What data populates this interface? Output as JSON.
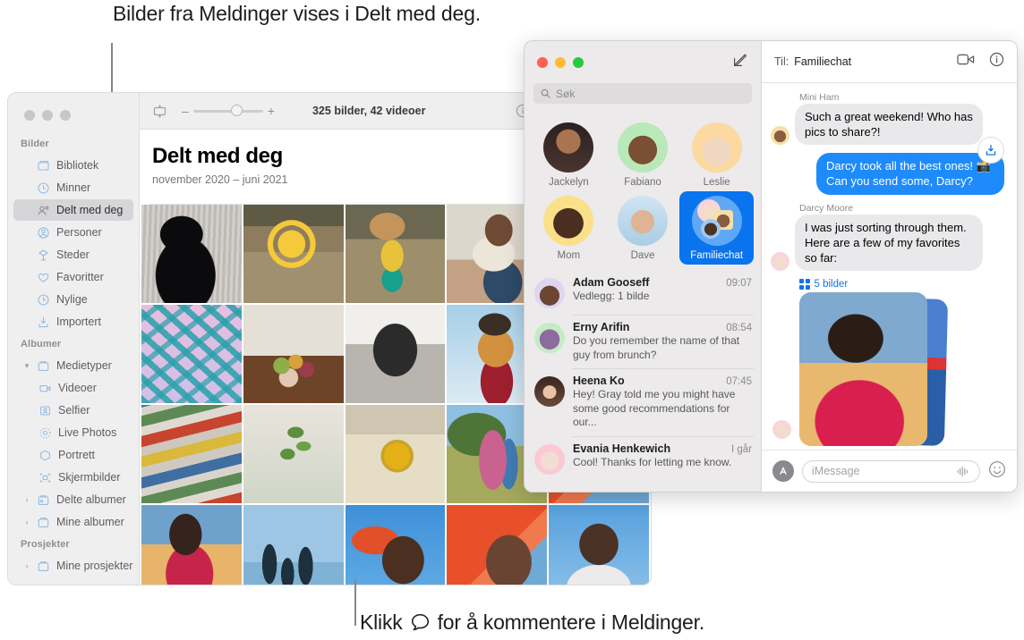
{
  "annotations": {
    "top": "Bilder fra Meldinger vises i Delt med deg.",
    "bottom_before": "Klikk",
    "bottom_after": "for å kommentere i Meldinger."
  },
  "photos": {
    "toolbar": {
      "count_label": "325 bilder, 42 videoer",
      "minus": "–",
      "plus": "+",
      "icons": [
        "slideshow-icon",
        "info-icon",
        "share-icon",
        "favorite-icon",
        "rotate-icon"
      ]
    },
    "header": {
      "title": "Delt med deg",
      "subtitle": "november 2020 – juni 2021"
    },
    "sidebar": {
      "sections": [
        {
          "heading": "Bilder",
          "items": [
            {
              "label": "Bibliotek",
              "icon": "library-icon",
              "selected": false,
              "indent": false,
              "chevron": ""
            },
            {
              "label": "Minner",
              "icon": "memories-icon",
              "selected": false,
              "indent": false,
              "chevron": ""
            },
            {
              "label": "Delt med deg",
              "icon": "shared-with-you-icon",
              "selected": true,
              "indent": false,
              "chevron": ""
            },
            {
              "label": "Personer",
              "icon": "people-icon",
              "selected": false,
              "indent": false,
              "chevron": ""
            },
            {
              "label": "Steder",
              "icon": "places-icon",
              "selected": false,
              "indent": false,
              "chevron": ""
            },
            {
              "label": "Favoritter",
              "icon": "heart-icon",
              "selected": false,
              "indent": false,
              "chevron": ""
            },
            {
              "label": "Nylige",
              "icon": "clock-icon",
              "selected": false,
              "indent": false,
              "chevron": ""
            },
            {
              "label": "Importert",
              "icon": "import-icon",
              "selected": false,
              "indent": false,
              "chevron": ""
            }
          ]
        },
        {
          "heading": "Albumer",
          "items": [
            {
              "label": "Medietyper",
              "icon": "folder-icon",
              "selected": false,
              "indent": false,
              "chevron": "▾"
            },
            {
              "label": "Videoer",
              "icon": "video-icon",
              "selected": false,
              "indent": true,
              "chevron": ""
            },
            {
              "label": "Selfier",
              "icon": "selfie-icon",
              "selected": false,
              "indent": true,
              "chevron": ""
            },
            {
              "label": "Live Photos",
              "icon": "live-photo-icon",
              "selected": false,
              "indent": true,
              "chevron": ""
            },
            {
              "label": "Portrett",
              "icon": "portrait-icon",
              "selected": false,
              "indent": true,
              "chevron": ""
            },
            {
              "label": "Skjermbilder",
              "icon": "screenshot-icon",
              "selected": false,
              "indent": true,
              "chevron": ""
            },
            {
              "label": "Delte albumer",
              "icon": "shared-album-icon",
              "selected": false,
              "indent": false,
              "chevron": "›"
            },
            {
              "label": "Mine albumer",
              "icon": "folder-icon",
              "selected": false,
              "indent": false,
              "chevron": "›"
            }
          ]
        },
        {
          "heading": "Prosjekter",
          "items": [
            {
              "label": "Mine prosjekter",
              "icon": "folder-icon",
              "selected": false,
              "indent": false,
              "chevron": "›"
            }
          ]
        }
      ]
    },
    "grid": [
      {
        "art": "a1",
        "comment": false
      },
      {
        "art": "a2",
        "comment": false
      },
      {
        "art": "a3",
        "comment": false
      },
      {
        "art": "a4",
        "comment": false
      },
      {
        "art": "a5",
        "comment": false
      },
      {
        "art": "a6",
        "comment": false
      },
      {
        "art": "a7",
        "comment": false
      },
      {
        "art": "a8",
        "comment": false
      },
      {
        "art": "a9",
        "comment": false
      },
      {
        "art": "a13",
        "comment": false
      },
      {
        "art": "a10",
        "comment": false
      },
      {
        "art": "a11",
        "comment": false
      },
      {
        "art": "a12",
        "comment": false
      },
      {
        "art": "a13",
        "comment": false
      },
      {
        "art": "a17",
        "comment": false
      },
      {
        "art": "a14",
        "comment": true
      },
      {
        "art": "a15",
        "comment": true
      },
      {
        "art": "a16",
        "comment": true
      },
      {
        "art": "a17",
        "comment": true
      },
      {
        "art": "a19",
        "comment": true
      }
    ]
  },
  "messages": {
    "search_placeholder": "Søk",
    "pinned": [
      {
        "name": "Jackelyn",
        "avatar": "av-jackelyn",
        "selected": false
      },
      {
        "name": "Fabiano",
        "avatar": "av-fabiano",
        "selected": false
      },
      {
        "name": "Leslie",
        "avatar": "av-leslie",
        "selected": false
      },
      {
        "name": "Mom",
        "avatar": "av-mom",
        "selected": false
      },
      {
        "name": "Dave",
        "avatar": "av-dave",
        "selected": false
      },
      {
        "name": "Familiechat",
        "avatar": "av-family",
        "selected": true
      }
    ],
    "conversations": [
      {
        "name": "Adam Gooseff",
        "time": "09:07",
        "preview": "Vedlegg: 1 bilde",
        "avatar": "av-adam"
      },
      {
        "name": "Erny Arifin",
        "time": "08:54",
        "preview": "Do you remember the name of that guy from brunch?",
        "avatar": "av-erny"
      },
      {
        "name": "Heena Ko",
        "time": "07:45",
        "preview": "Hey! Gray told me you might have some good recommendations for our...",
        "avatar": "av-heena"
      },
      {
        "name": "Evania Henkewich",
        "time": "I går",
        "preview": "Cool! Thanks for letting me know.",
        "avatar": "av-evania"
      }
    ],
    "thread": {
      "to_label": "Til:",
      "to_name": "Familiechat",
      "bubbles": [
        {
          "sender": "Mini Ham",
          "text": "Such a great weekend! Who has pics to share?!",
          "dir": "in",
          "avatar": "av-miniham"
        },
        {
          "sender": "",
          "text": "Darcy took all the best ones! 📸 Can you send some, Darcy?",
          "dir": "out",
          "avatar": ""
        },
        {
          "sender": "Darcy Moore",
          "text": "I was just sorting through them. Here are a few of my favorites so far:",
          "dir": "in",
          "avatar": "av-darcy"
        }
      ],
      "attachment_label": "5 bilder",
      "actions": [
        "facetime-icon",
        "info-icon"
      ]
    },
    "composer": {
      "placeholder": "iMessage",
      "apps_icon": "app-store-icon",
      "audio_icon": "audio-waveform-icon",
      "emoji_icon": "emoji-icon"
    }
  },
  "colors": {
    "accent_blue": "#0a73ee",
    "bubble_out": "#1e8bfb",
    "bubble_in": "#e9e9eb",
    "link_blue": "#1473e6"
  }
}
